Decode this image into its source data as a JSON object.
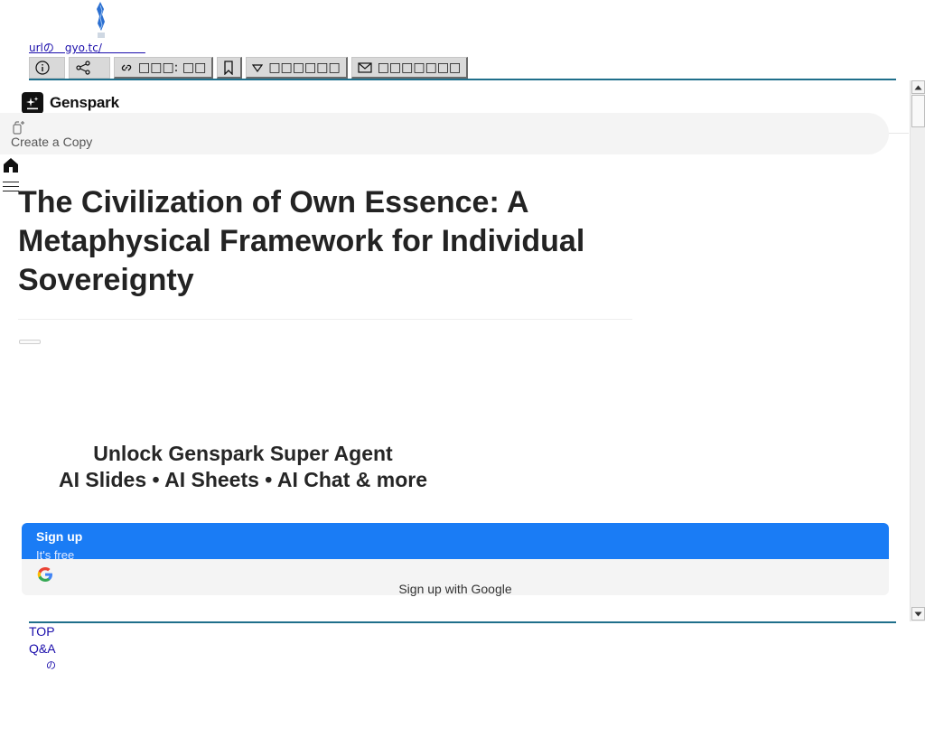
{
  "host": {
    "url_text": "urlの　gyo.tc/　　　　",
    "toolbar": [
      {
        "id": "info",
        "icon": "info-icon",
        "label": ""
      },
      {
        "id": "share",
        "icon": "share-icon",
        "label": ""
      },
      {
        "id": "link",
        "icon": "link-icon",
        "label": "□□□: □□"
      },
      {
        "id": "bookmark",
        "icon": "bookmark-icon",
        "label": ""
      },
      {
        "id": "filter",
        "icon": "triangle-down-icon",
        "label": "□□□□□□"
      },
      {
        "id": "mail",
        "icon": "mail-icon",
        "label": "□□□□□□□"
      }
    ],
    "footer_links": [
      "TOP",
      "Q&A",
      "の"
    ]
  },
  "app": {
    "brand_name": "Genspark",
    "copy_label": "Create a Copy",
    "title": "The Civilization of Own Essence: A Metaphysical Framework for Individual Sovereignty",
    "promo": {
      "line1": "Unlock Genspark Super Agent",
      "line2": "AI Slides • AI Sheets • AI Chat & more"
    },
    "signup": {
      "label": "Sign up",
      "sub": "It's free",
      "google_label": "Sign up with Google"
    }
  },
  "colors": {
    "accent_blue": "#1a7cf5",
    "host_rule": "#1f6f8b",
    "link": "#1a0dab"
  }
}
